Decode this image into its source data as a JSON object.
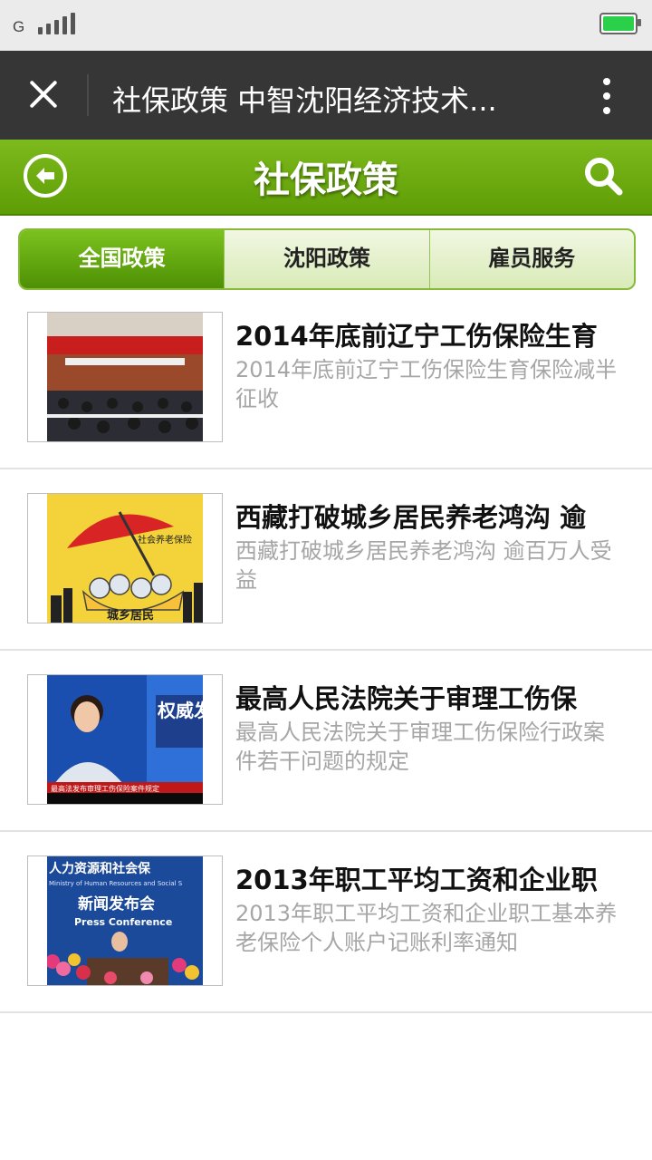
{
  "status_bar": {
    "network": "G",
    "signal_icon": "signal-bars-icon",
    "battery_icon": "battery-icon",
    "battery_color": "#2ad04a"
  },
  "titlebar": {
    "title": "社保政策 中智沈阳经济技术...",
    "close_icon": "close-icon",
    "more_icon": "more-vertical-icon"
  },
  "header": {
    "title": "社保政策",
    "back_icon": "back-circle-icon",
    "search_icon": "search-icon",
    "accent": "#6aaa0e"
  },
  "tabs": [
    {
      "label": "全国政策",
      "active": true
    },
    {
      "label": "沈阳政策",
      "active": false
    },
    {
      "label": "雇员服务",
      "active": false
    }
  ],
  "articles": [
    {
      "title": "2014年底前辽宁工伤保险生育",
      "desc": "2014年底前辽宁工伤保险生育保险减半征收",
      "thumb_icon": "conference-photo-icon"
    },
    {
      "title": "西藏打破城乡居民养老鸿沟 逾",
      "desc": "西藏打破城乡居民养老鸿沟 逾百万人受益",
      "thumb_icon": "umbrella-cartoon-icon",
      "thumb_labels": [
        "社会养老保险",
        "城乡居民"
      ]
    },
    {
      "title": "最高人民法院关于审理工伤保",
      "desc": "最高人民法院关于审理工伤保险行政案件若干问题的规定",
      "thumb_icon": "news-broadcast-icon",
      "thumb_labels": [
        "权威发布",
        "最高法发布审理工伤保险案件规定"
      ]
    },
    {
      "title": "2013年职工平均工资和企业职",
      "desc": "2013年职工平均工资和企业职工基本养老保险个人账户记账利率通知",
      "thumb_icon": "press-conference-icon",
      "thumb_labels": [
        "人力资源和社会保",
        "Ministry of Human Resources and Social S",
        "新闻发布会",
        "Press Conference"
      ]
    }
  ]
}
